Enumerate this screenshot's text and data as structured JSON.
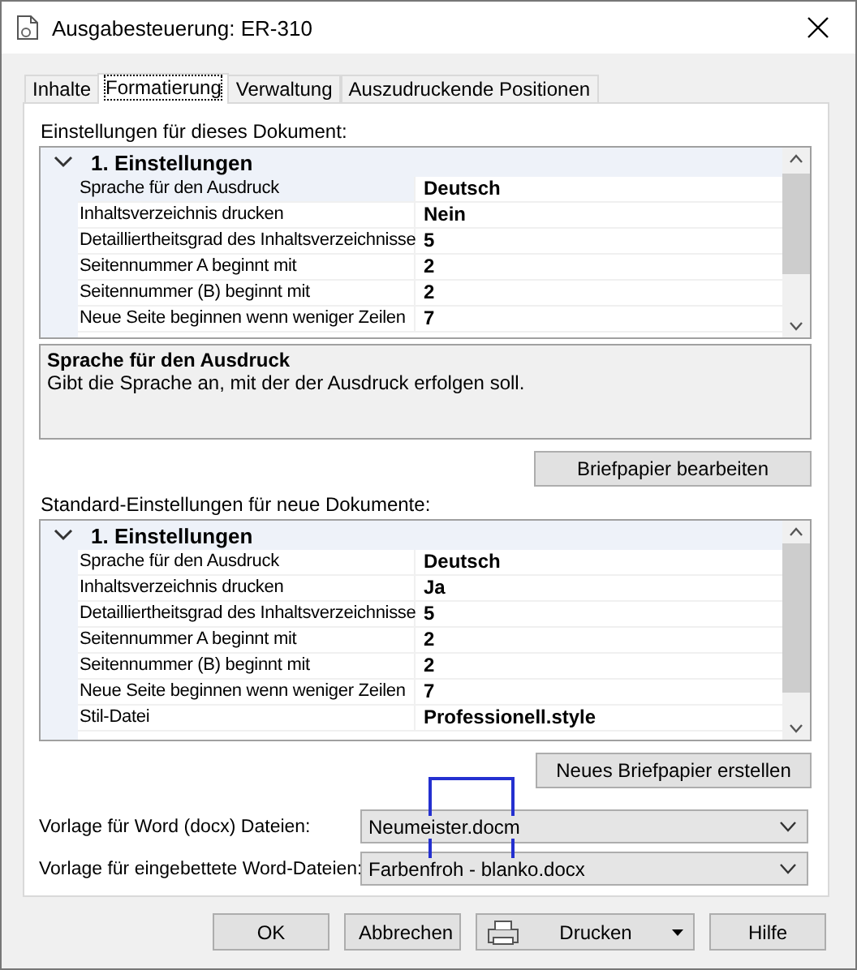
{
  "window": {
    "title": "Ausgabesteuerung: ER-310"
  },
  "tabs": [
    {
      "label": "Inhalte",
      "selected": false
    },
    {
      "label": "Formatierung",
      "selected": true
    },
    {
      "label": "Verwaltung",
      "selected": false
    },
    {
      "label": "Auszudruckende Positionen",
      "selected": false
    }
  ],
  "document_settings": {
    "label": "Einstellungen für dieses Dokument:",
    "grid": {
      "category": "1. Einstellungen",
      "expanded": true,
      "rows": [
        {
          "name": "Sprache für den Ausdruck",
          "value": "Deutsch",
          "selected": true
        },
        {
          "name": "Inhaltsverzeichnis drucken",
          "value": "Nein",
          "selected": false
        },
        {
          "name": "Detailliertheitsgrad des Inhaltsverzeichnisse",
          "value": "5",
          "selected": false
        },
        {
          "name": "Seitennummer A beginnt mit",
          "value": "2",
          "selected": false
        },
        {
          "name": "Seitennummer (B) beginnt mit",
          "value": "2",
          "selected": false
        },
        {
          "name": "Neue Seite beginnen wenn weniger Zeilen",
          "value": "7",
          "selected": false
        }
      ]
    },
    "description": {
      "title": "Sprache für den Ausdruck",
      "text": "Gibt die Sprache an, mit der der Ausdruck erfolgen soll."
    },
    "button": "Briefpapier bearbeiten"
  },
  "default_settings": {
    "label": "Standard-Einstellungen für neue Dokumente:",
    "grid": {
      "category": "1. Einstellungen",
      "expanded": true,
      "rows": [
        {
          "name": "Sprache für den Ausdruck",
          "value": "Deutsch",
          "selected": false
        },
        {
          "name": "Inhaltsverzeichnis drucken",
          "value": "Ja",
          "selected": false
        },
        {
          "name": "Detailliertheitsgrad des Inhaltsverzeichnisse",
          "value": "5",
          "selected": false
        },
        {
          "name": "Seitennummer A beginnt mit",
          "value": "2",
          "selected": false
        },
        {
          "name": "Seitennummer (B) beginnt mit",
          "value": "2",
          "selected": false
        },
        {
          "name": "Neue Seite beginnen wenn weniger Zeilen",
          "value": "7",
          "selected": false
        },
        {
          "name": "Stil-Datei",
          "value": "Professionell.style",
          "selected": false
        }
      ]
    },
    "button": "Neues Briefpapier erstellen"
  },
  "templates": [
    {
      "label": "Vorlage für Word (docx) Dateien:",
      "value": "Neumeister.docm"
    },
    {
      "label": "Vorlage für eingebettete Word-Dateien:",
      "value": "Farbenfroh - blanko.docx"
    }
  ],
  "buttons": [
    {
      "label": "OK",
      "kind": "plain"
    },
    {
      "label": "Abbrechen",
      "kind": "plain"
    },
    {
      "label": "Drucken",
      "kind": "print"
    },
    {
      "label": "Hilfe",
      "kind": "plain"
    }
  ]
}
